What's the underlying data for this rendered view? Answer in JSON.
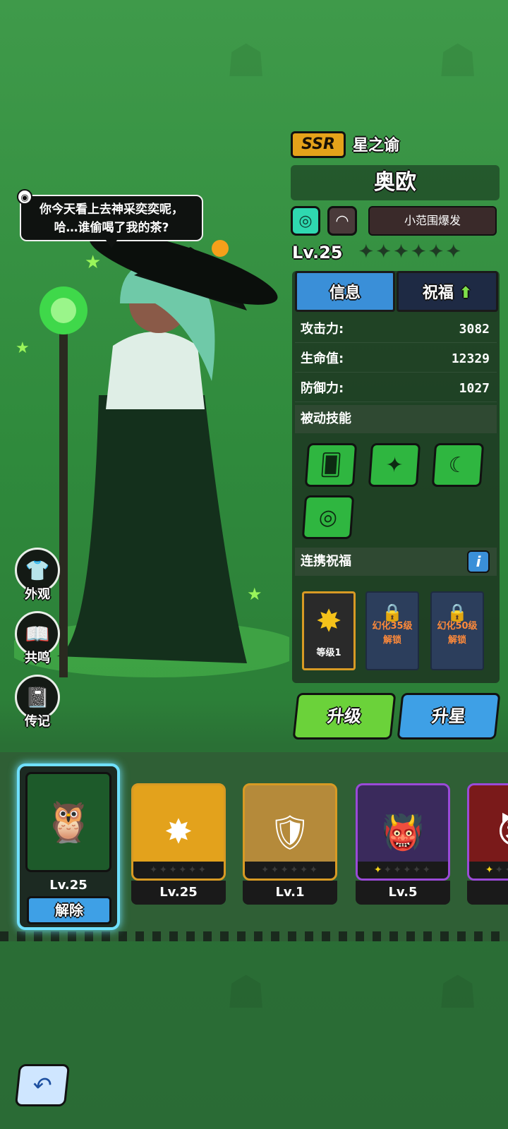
{
  "speech": {
    "text_line1": "你今天看上去神采奕奕呢，",
    "text_line2": "哈…谁偷喝了我的茶?"
  },
  "side_menu": [
    {
      "label": "外观",
      "icon": "shirt-icon"
    },
    {
      "label": "共鸣",
      "icon": "book-icon"
    },
    {
      "label": "传记",
      "icon": "journal-icon"
    }
  ],
  "hero": {
    "rarity": "SSR",
    "title": "星之谕",
    "name": "奥欧",
    "skill_tag": "小范围爆发",
    "level": "Lv.25",
    "stars_filled": 0,
    "stars_total": 6
  },
  "tabs": {
    "info": "信息",
    "bless": "祝福"
  },
  "stats": [
    {
      "label": "攻击力:",
      "value": "3082"
    },
    {
      "label": "生命值:",
      "value": "12329"
    },
    {
      "label": "防御力:",
      "value": "1027"
    }
  ],
  "sections": {
    "passive": "被动技能",
    "link_bless": "连携祝福"
  },
  "bless_cards": [
    {
      "label": "等级1",
      "locked": false
    },
    {
      "label_line1": "幻化35级",
      "label_line2": "解锁",
      "locked": true
    },
    {
      "label_line1": "幻化50级",
      "label_line2": "解锁",
      "locked": true
    }
  ],
  "buttons": {
    "upgrade": "升级",
    "star_up": "升星",
    "release": "解除"
  },
  "roster": [
    {
      "level": "Lv.25",
      "selected": true,
      "frame_color": "#1d5a2a"
    },
    {
      "level": "Lv.25",
      "frame_color": "#d89a24",
      "bg": "#e3a21c"
    },
    {
      "level": "Lv.1",
      "frame_color": "#d89a24",
      "bg": "#b58a3a"
    },
    {
      "level": "Lv.5",
      "frame_color": "#9a4ad8",
      "bg": "#3a2a5c"
    },
    {
      "level": "L",
      "frame_color": "#9a4ad8",
      "bg": "#7a1a1a"
    }
  ],
  "colors": {
    "accent_blue": "#3ea0e6",
    "accent_green": "#6bd23a",
    "ssr_gold": "#e5a21a"
  }
}
